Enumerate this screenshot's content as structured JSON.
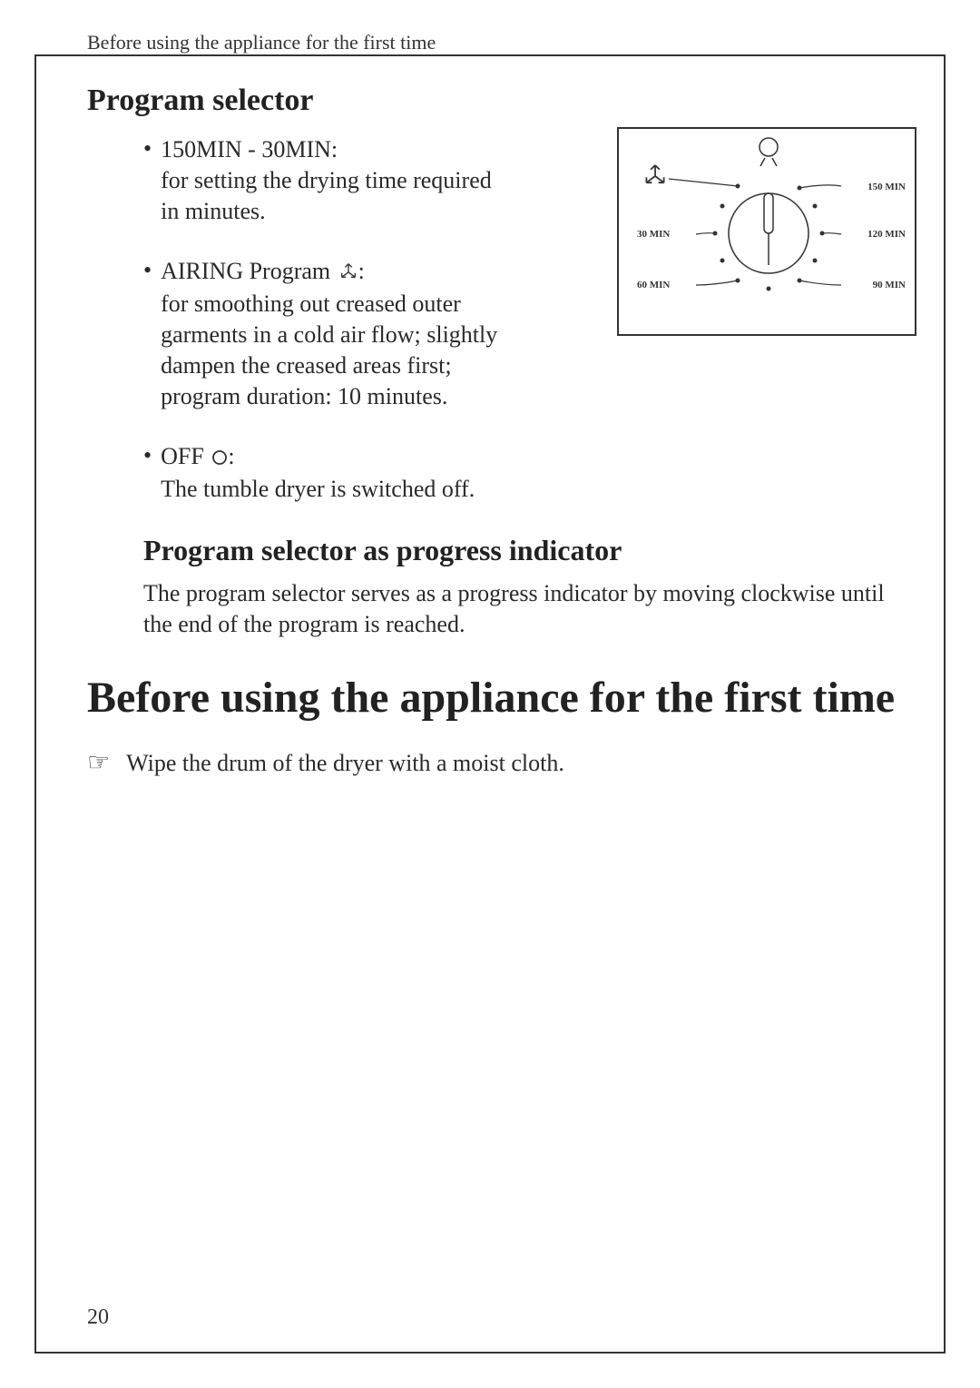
{
  "header": "Before using the appliance for the first time",
  "section1": {
    "title": "Program selector",
    "bullets": [
      {
        "head": "150MIN - 30MIN:",
        "body": "for setting the drying time required in minutes."
      },
      {
        "head": "AIRING Program",
        "body": "for smoothing out creased outer garments in a cold air flow; slightly dampen the creased areas first;",
        "body2": "program duration: 10 minutes."
      },
      {
        "head": "OFF",
        "body": "The tumble dryer is switched off."
      }
    ]
  },
  "section2": {
    "title": "Program selector as progress indicator",
    "body": "The program selector serves as a progress indicator by moving clockwise until the end of the program is reached."
  },
  "mainTitle": "Before using the appliance for the first time",
  "instruction": "Wipe the drum of the dryer with a moist cloth.",
  "dial": {
    "labels": {
      "l150": "150 MIN",
      "l120": "120 MIN",
      "l90": "90 MIN",
      "l60": "60 MIN",
      "l30": "30 MIN"
    }
  },
  "pageNumber": "20"
}
